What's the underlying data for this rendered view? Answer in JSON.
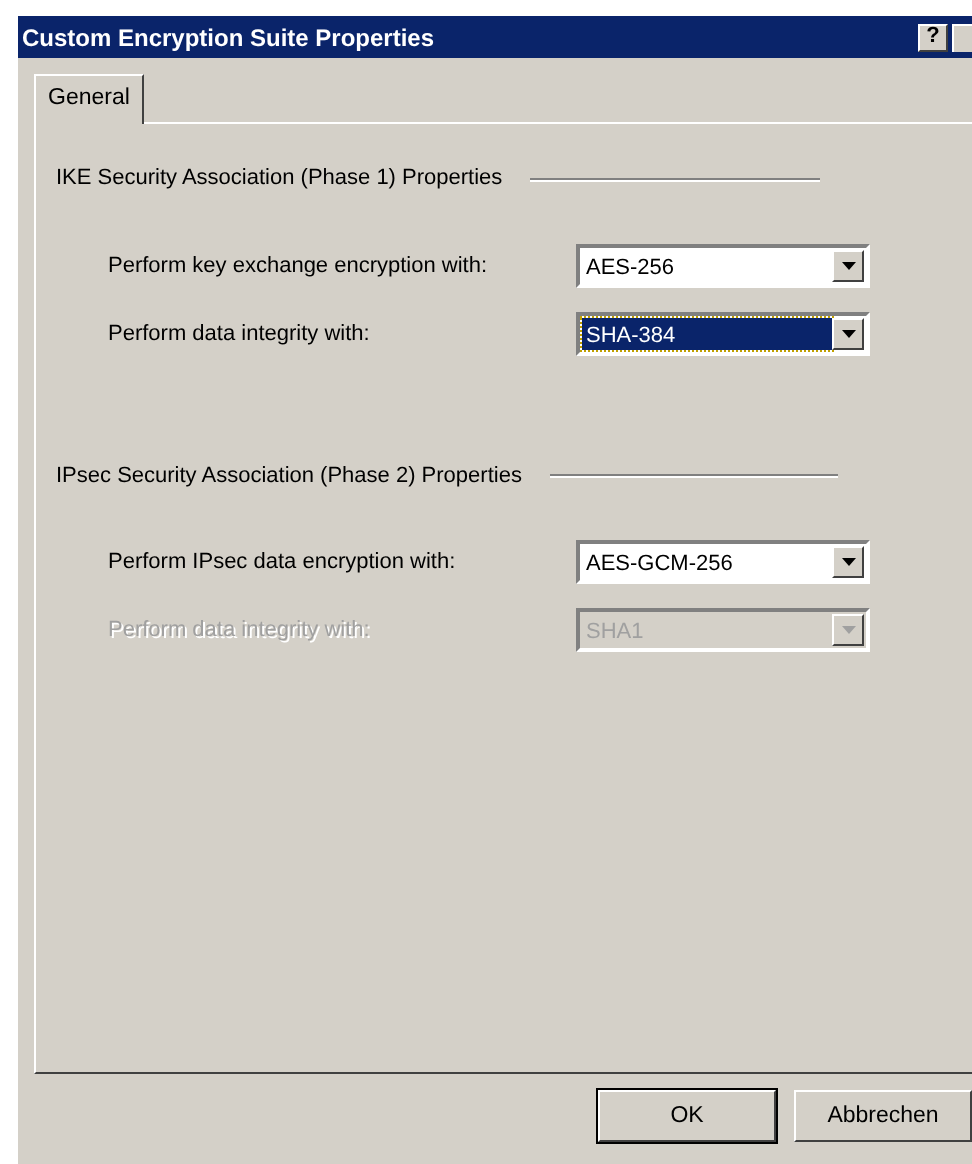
{
  "window": {
    "title": "Custom Encryption Suite Properties",
    "help_button": "?"
  },
  "tabs": [
    {
      "label": "General",
      "selected": true
    }
  ],
  "groups": [
    {
      "title": "IKE Security Association (Phase 1) Properties",
      "rows": [
        {
          "label": "Perform key exchange encryption with:",
          "value": "AES-256",
          "focused": false,
          "disabled": false
        },
        {
          "label": "Perform data integrity with:",
          "value": "SHA-384",
          "focused": true,
          "disabled": false
        }
      ]
    },
    {
      "title": "IPsec Security Association (Phase 2) Properties",
      "rows": [
        {
          "label": "Perform IPsec data encryption with:",
          "value": "AES-GCM-256",
          "focused": false,
          "disabled": false
        },
        {
          "label": "Perform data integrity with:",
          "value": "SHA1",
          "focused": false,
          "disabled": true
        }
      ]
    }
  ],
  "buttons": [
    "OK",
    "Abbrechen"
  ]
}
